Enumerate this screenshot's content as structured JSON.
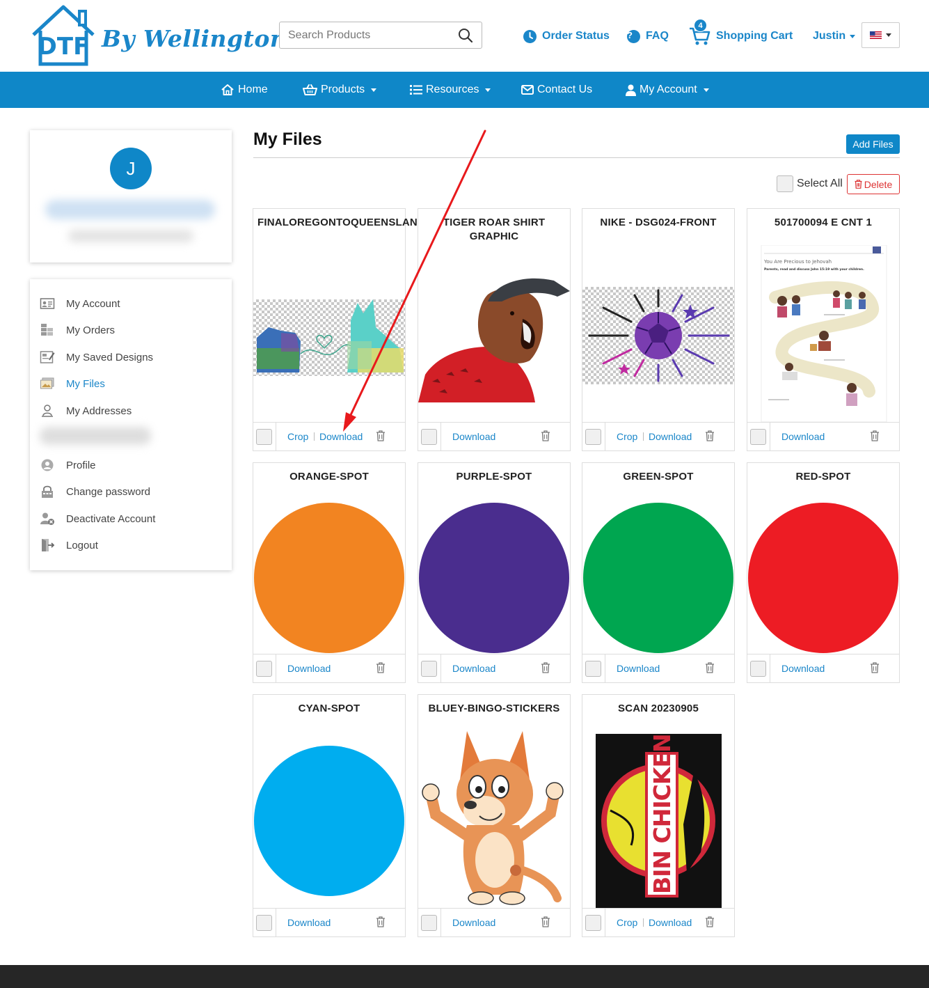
{
  "header": {
    "logo_mark": "DTF",
    "logo_script": "By Wellington",
    "search_placeholder": "Search Products",
    "order_status": "Order Status",
    "faq": "FAQ",
    "cart_count": "4",
    "shopping_cart": "Shopping Cart",
    "user": "Justin",
    "flag_icon": "us-flag-icon"
  },
  "nav": {
    "home": "Home",
    "products": "Products",
    "resources": "Resources",
    "contact": "Contact Us",
    "account": "My Account"
  },
  "profile": {
    "initial": "J"
  },
  "sidebar": {
    "items": [
      {
        "label": "My Account",
        "icon": "id-card-icon"
      },
      {
        "label": "My Orders",
        "icon": "orders-icon"
      },
      {
        "label": "My Saved Designs",
        "icon": "designs-icon"
      },
      {
        "label": "My Files",
        "icon": "images-icon"
      },
      {
        "label": "My Addresses",
        "icon": "address-icon"
      },
      {
        "label": "Profile",
        "icon": "user-circle-icon"
      },
      {
        "label": "Change password",
        "icon": "lock-icon"
      },
      {
        "label": "Deactivate Account",
        "icon": "user-remove-icon"
      },
      {
        "label": "Logout",
        "icon": "logout-icon"
      }
    ]
  },
  "main": {
    "title": "My Files",
    "add_files": "Add Files",
    "select_all": "Select All",
    "delete": "Delete",
    "crop": "Crop",
    "download": "Download"
  },
  "files": [
    {
      "title": "FINALOREGONTOQUEENSLAND",
      "crop": true
    },
    {
      "title": "TIGER ROAR SHIRT GRAPHIC",
      "crop": false
    },
    {
      "title": "NIKE - DSG024-FRONT",
      "crop": true
    },
    {
      "title": "501700094 E CNT 1",
      "crop": false
    },
    {
      "title": "ORANGE-SPOT",
      "crop": false,
      "color": "#f28421"
    },
    {
      "title": "PURPLE-SPOT",
      "crop": false,
      "color": "#4a2d8e"
    },
    {
      "title": "GREEN-SPOT",
      "crop": false,
      "color": "#00a650"
    },
    {
      "title": "RED-SPOT",
      "crop": false,
      "color": "#ed1c24"
    },
    {
      "title": "CYAN-SPOT",
      "crop": false,
      "color": "#00adef"
    },
    {
      "title": "BLUEY-BINGO-STICKERS",
      "crop": false
    },
    {
      "title": "SCAN 20230905",
      "crop": true
    }
  ],
  "thumbnail_text": {
    "worksheet_heading": "You Are Precious to Jehovah",
    "worksheet_instruction": "Parents, read and discuss John 15:19 with your children.",
    "sticker_text": "BIN CHICKEN"
  },
  "colors": {
    "brand_blue": "#0f87c8",
    "link_blue": "#1a86c9",
    "delete_red": "#dd3333",
    "annotation_arrow": "#e8191c"
  }
}
